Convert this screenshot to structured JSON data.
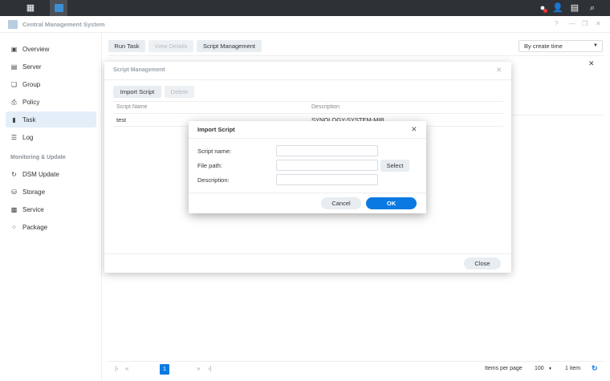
{
  "app": {
    "title": "Central Management System"
  },
  "taskbar": {
    "icons": [
      "apps-grid-icon",
      "cms-app-icon",
      "chat-icon",
      "user-icon",
      "widgets-icon",
      "search-icon"
    ]
  },
  "sidebar": {
    "items": [
      {
        "label": "Overview"
      },
      {
        "label": "Server"
      },
      {
        "label": "Group"
      },
      {
        "label": "Policy"
      },
      {
        "label": "Task"
      },
      {
        "label": "Log"
      }
    ],
    "section": "Monitoring & Update",
    "items2": [
      {
        "label": "DSM Update"
      },
      {
        "label": "Storage"
      },
      {
        "label": "Service"
      },
      {
        "label": "Package"
      }
    ]
  },
  "toolbar": {
    "run_task": "Run Task",
    "view_details": "View Details",
    "script_management": "Script Management",
    "sort": "By create time"
  },
  "script_modal": {
    "title": "Script Management",
    "import": "Import Script",
    "delete": "Delete",
    "col_name": "Script Name",
    "col_desc": "Description",
    "rows": [
      {
        "name": "test",
        "desc": "SYNOLOGY-SYSTEM-MIB"
      }
    ],
    "close": "Close"
  },
  "import_dialog": {
    "title": "Import Script",
    "script_name": "Script name:",
    "file_path": "File path:",
    "description": "Description:",
    "select": "Select",
    "cancel": "Cancel",
    "ok": "OK",
    "values": {
      "script_name": "",
      "file_path": "",
      "description": ""
    }
  },
  "pagination": {
    "page": "1",
    "items_per_page_label": "Items per page",
    "per_page": "100",
    "count": "1 item"
  },
  "colors": {
    "accent": "#0a7ae2",
    "taskbar": "#2e3236"
  }
}
